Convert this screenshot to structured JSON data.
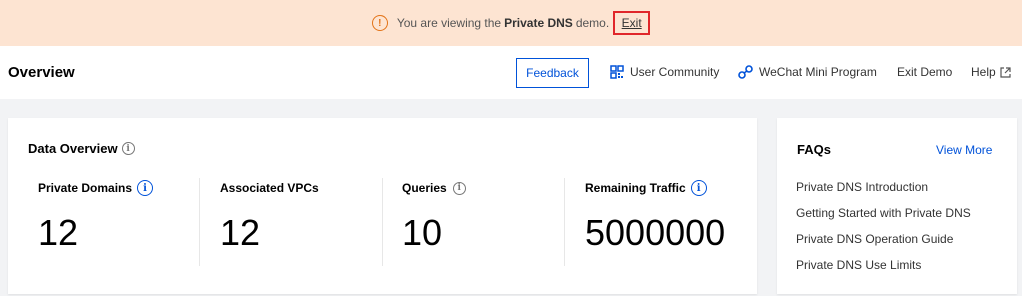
{
  "banner": {
    "prefix": "You are viewing the",
    "product": "Private DNS",
    "suffix": "demo.",
    "exit_label": "Exit"
  },
  "header": {
    "title": "Overview",
    "feedback_label": "Feedback",
    "user_community_label": "User Community",
    "wechat_label": "WeChat Mini Program",
    "exit_demo_label": "Exit Demo",
    "help_label": "Help"
  },
  "data_overview": {
    "title": "Data Overview",
    "stats": [
      {
        "label": "Private Domains",
        "value": "12"
      },
      {
        "label": "Associated VPCs",
        "value": "12"
      },
      {
        "label": "Queries",
        "value": "10"
      },
      {
        "label": "Remaining Traffic",
        "value": "5000000"
      }
    ]
  },
  "faqs": {
    "title": "FAQs",
    "view_more_label": "View More",
    "items": [
      "Private DNS Introduction",
      "Getting Started with Private DNS",
      "Private DNS Operation Guide",
      "Private DNS Use Limits"
    ]
  },
  "colors": {
    "banner_bg": "#fde4d2",
    "warning": "#e37318",
    "accent": "#0052d9",
    "exit_highlight": "#e0262a"
  }
}
